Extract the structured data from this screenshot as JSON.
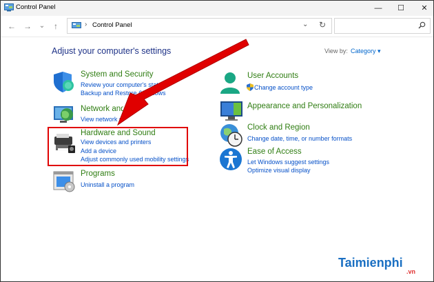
{
  "window": {
    "title": "Control Panel",
    "minimize": "—",
    "maximize": "☐",
    "close": "✕"
  },
  "nav": {
    "back": "←",
    "forward": "→",
    "recent": "⌄",
    "up": "↑",
    "breadcrumb_sep": "›",
    "breadcrumb": "Control Panel",
    "address_dropdown": "⌄",
    "refresh": "↻",
    "search_placeholder": ""
  },
  "main": {
    "heading": "Adjust your computer's settings",
    "view_by_label": "View by:",
    "view_by_value": "Category ▾"
  },
  "categories_left": [
    {
      "title": "System and Security",
      "links": [
        "Review your computer's status",
        "Backup and Restore (Windows"
      ]
    },
    {
      "title": "Network and Internet",
      "links": [
        "View network status"
      ]
    },
    {
      "title": "Hardware and Sound",
      "links": [
        "View devices and printers",
        "Add a device",
        "Adjust commonly used mobility settings"
      ]
    },
    {
      "title": "Programs",
      "links": [
        "Uninstall a program"
      ]
    }
  ],
  "categories_right": [
    {
      "title": "User Accounts",
      "links": [
        "Change account type"
      ]
    },
    {
      "title": "Appearance and Personalization",
      "links": []
    },
    {
      "title": "Clock and Region",
      "links": [
        "Change date, time, or number formats"
      ]
    },
    {
      "title": "Ease of Access",
      "links": [
        "Let Windows suggest settings",
        "Optimize visual display"
      ]
    }
  ],
  "watermark": {
    "brand": "Taimienphi",
    "tld": ".vn"
  },
  "colors": {
    "heading": "#1e3287",
    "category": "#2f7d12",
    "link": "#0550c8",
    "annotation": "#e00000"
  }
}
